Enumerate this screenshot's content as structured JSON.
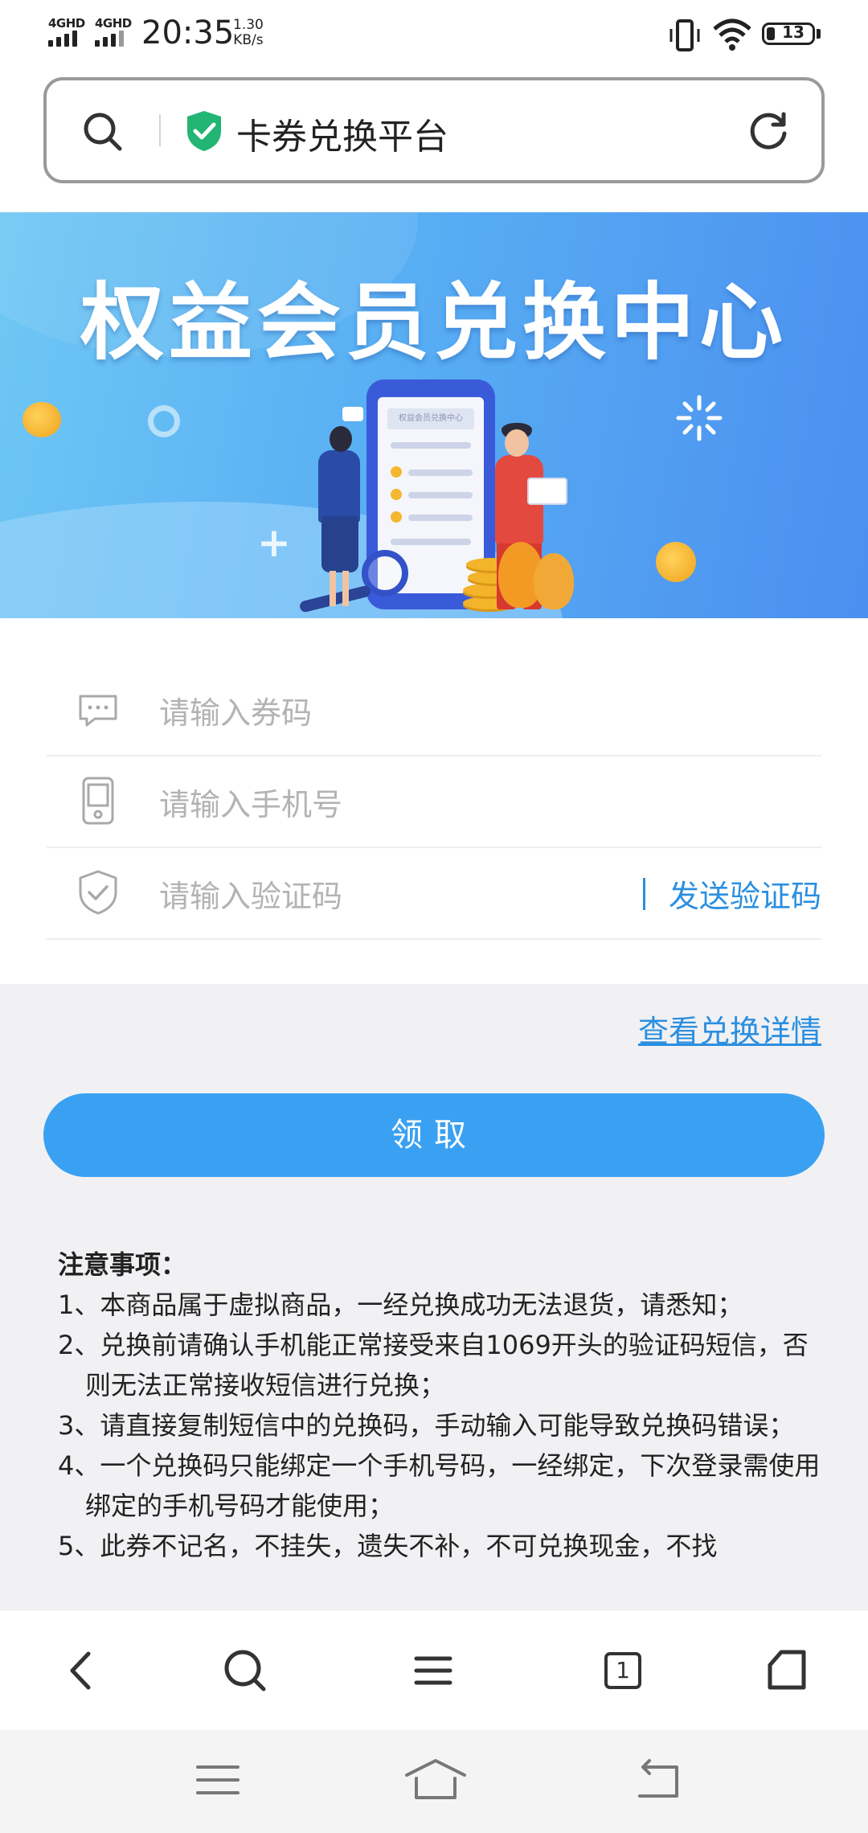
{
  "status_bar": {
    "signal_1": "4GHD",
    "signal_2": "4GHD",
    "time": "20:35",
    "speed_value": "1.30",
    "speed_unit": "KB/s",
    "battery": "13"
  },
  "address_bar": {
    "title": "卡券兑换平台",
    "search_icon": "search-icon",
    "secure_icon": "shield-check-icon",
    "reload_icon": "reload-icon"
  },
  "banner": {
    "title": "权益会员兑换中心",
    "phone_screen_title": "权益会员兑换中心"
  },
  "form": {
    "coupon_placeholder": "请输入券码",
    "phone_placeholder": "请输入手机号",
    "code_placeholder": "请输入验证码",
    "send_code_label": "发送验证码"
  },
  "details_link": "查看兑换详情",
  "claim_button": "领取",
  "notes": {
    "heading": "注意事项：",
    "items": [
      "1、本商品属于虚拟商品，一经兑换成功无法退货，请悉知；",
      "2、兑换前请确认手机能正常接受来自1069开头的验证码短信，否则无法正常接收短信进行兑换；",
      "3、请直接复制短信中的兑换码，手动输入可能导致兑换码错误；",
      "4、一个兑换码只能绑定一个手机号码，一经绑定，下次登录需使用绑定的手机号码才能使用；",
      "5、此券不记名，不挂失，遗失不补，不可兑换现金，不找"
    ]
  },
  "browser_toolbar": {
    "tab_count": "1",
    "icons": [
      "back-icon",
      "search-icon",
      "menu-icon",
      "tabs-icon",
      "home-icon"
    ]
  },
  "system_nav": {
    "icons": [
      "recent-apps-icon",
      "home-icon",
      "back-icon"
    ]
  },
  "colors": {
    "accent": "#3aa1f2",
    "link": "#2b8fe0",
    "secure": "#22b573",
    "grey_bg": "#f1f1f4"
  }
}
